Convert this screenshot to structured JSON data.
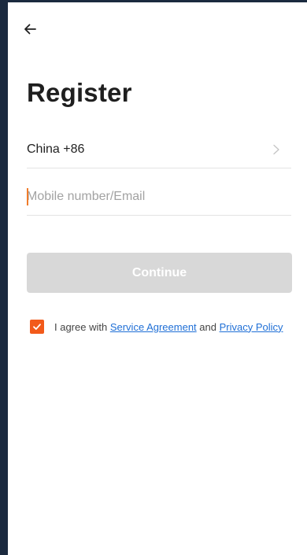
{
  "header": {
    "back_icon": "arrow-left-icon"
  },
  "page": {
    "title": "Register"
  },
  "form": {
    "country_label": "China +86",
    "chevron_icon": "chevron-right-icon",
    "account_placeholder": "Mobile number/Email",
    "account_value": "",
    "continue_label": "Continue"
  },
  "agreement": {
    "checked": true,
    "prefix": "I agree with ",
    "service_link": "Service Agreement",
    "middle": " and ",
    "privacy_link": "Privacy Policy"
  },
  "colors": {
    "frame_background": "#1b2a3f",
    "accent": "#f25a1a",
    "link": "#1f6fd6",
    "button_disabled": "#d8d8d8"
  }
}
